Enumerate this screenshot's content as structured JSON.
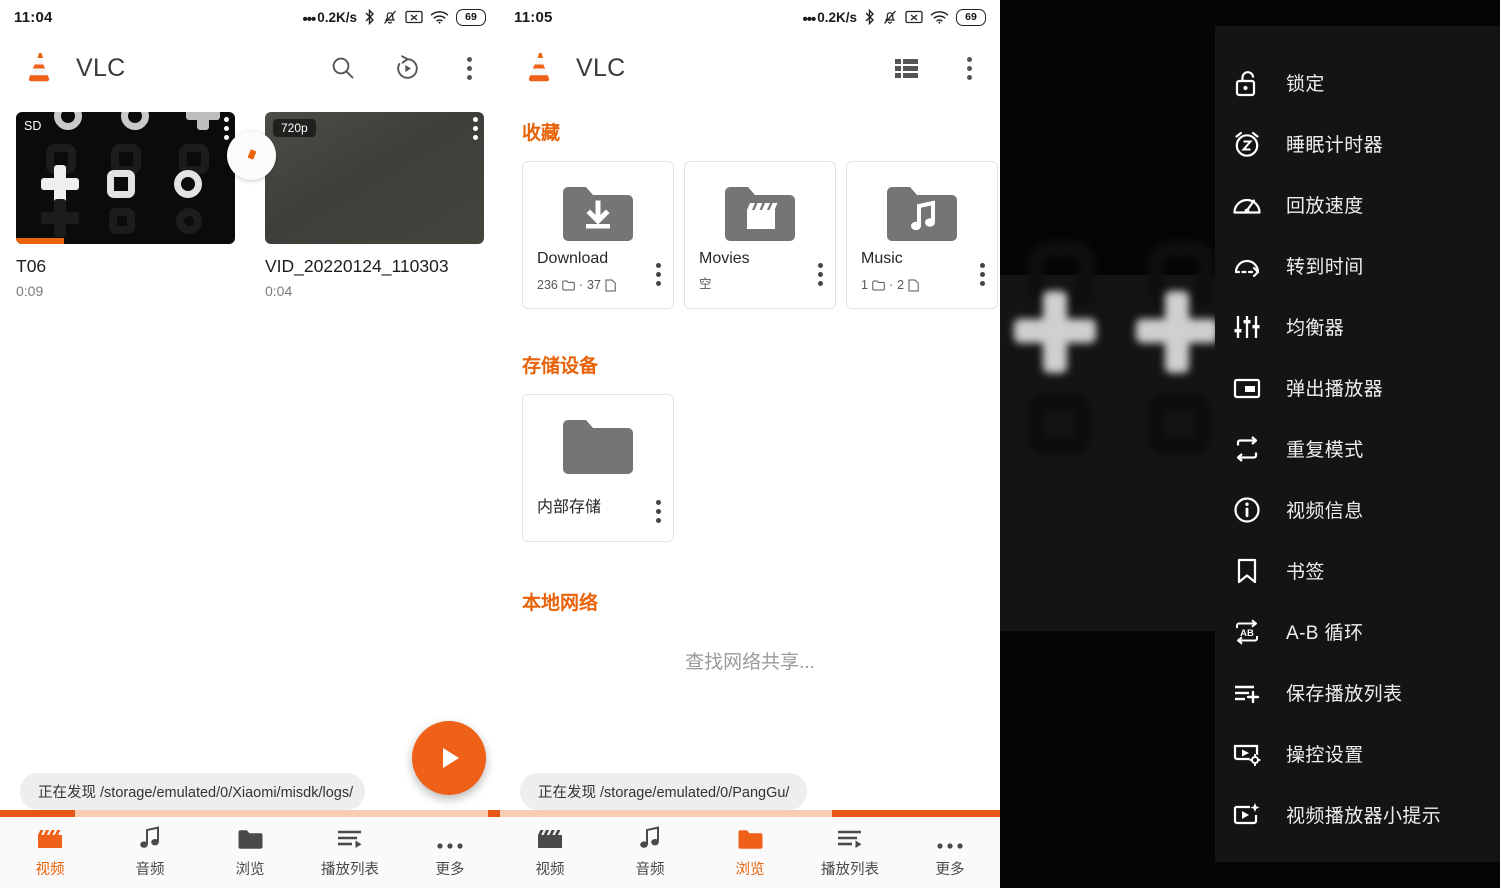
{
  "panels": {
    "left": {
      "statusbar": {
        "time": "11:04",
        "net_speed": "0.2K/s",
        "battery": "69",
        "icons": [
          "bluetooth-icon",
          "notification-muted-icon",
          "no-sim-icon",
          "wifi-icon",
          "battery-icon"
        ]
      },
      "toolbar": {
        "title": "VLC",
        "actions": [
          "search-icon",
          "history-icon",
          "overflow-menu-icon"
        ]
      },
      "videos": [
        {
          "name": "T06",
          "duration": "0:09",
          "quality": "SD",
          "progress_pct": 22
        },
        {
          "name": "VID_20220124_110303",
          "duration": "0:04",
          "quality": "720p",
          "progress_pct": 0
        }
      ],
      "discover_label": "正在发现",
      "discover_path": "/storage/emulated/0/Xiaomi/misdk/logs/",
      "fab": "play-icon",
      "nav": [
        {
          "label": "视频",
          "icon": "clapperboard-icon",
          "active": true
        },
        {
          "label": "音频",
          "icon": "music-note-icon",
          "active": false
        },
        {
          "label": "浏览",
          "icon": "folder-icon",
          "active": false
        },
        {
          "label": "播放列表",
          "icon": "playlist-icon",
          "active": false
        },
        {
          "label": "更多",
          "icon": "more-icon",
          "active": false
        }
      ]
    },
    "middle": {
      "statusbar": {
        "time": "11:05",
        "net_speed": "0.2K/s",
        "battery": "69"
      },
      "toolbar": {
        "title": "VLC",
        "actions": [
          "list-view-icon",
          "overflow-menu-icon"
        ]
      },
      "sections": [
        {
          "title": "收藏",
          "cards": [
            {
              "name": "Download",
              "icon": "folder-download-icon",
              "folders": "236",
              "files": "37",
              "separator": "·",
              "empty": ""
            },
            {
              "name": "Movies",
              "icon": "folder-movie-icon",
              "folders": "",
              "files": "",
              "separator": "",
              "empty": "空"
            },
            {
              "name": "Music",
              "icon": "folder-music-icon",
              "folders": "1",
              "files": "2",
              "separator": "·",
              "empty": ""
            }
          ]
        },
        {
          "title": "存储设备",
          "cards": [
            {
              "name": "内部存储",
              "icon": "folder-icon",
              "folders": "",
              "files": "",
              "separator": "",
              "empty": ""
            }
          ]
        },
        {
          "title": "本地网络",
          "empty_text": "查找网络共享..."
        }
      ],
      "discover_label": "正在发现",
      "discover_path": "/storage/emulated/0/PangGu/",
      "fab": "plus-icon",
      "nav": [
        {
          "label": "视频",
          "icon": "clapperboard-icon",
          "active": false
        },
        {
          "label": "音频",
          "icon": "music-note-icon",
          "active": false
        },
        {
          "label": "浏览",
          "icon": "folder-icon",
          "active": true
        },
        {
          "label": "播放列表",
          "icon": "playlist-icon",
          "active": false
        },
        {
          "label": "更多",
          "icon": "more-icon",
          "active": false
        }
      ]
    },
    "right": {
      "menu_items": [
        {
          "label": "锁定",
          "icon": "lock-open-icon"
        },
        {
          "label": "睡眠计时器",
          "icon": "sleep-timer-icon"
        },
        {
          "label": "回放速度",
          "icon": "speedometer-icon"
        },
        {
          "label": "转到时间",
          "icon": "jump-to-time-icon"
        },
        {
          "label": "均衡器",
          "icon": "equalizer-icon"
        },
        {
          "label": "弹出播放器",
          "icon": "popup-player-icon"
        },
        {
          "label": "重复模式",
          "icon": "repeat-icon"
        },
        {
          "label": "视频信息",
          "icon": "info-icon"
        },
        {
          "label": "书签",
          "icon": "bookmark-icon"
        },
        {
          "label": "A-B 循环",
          "icon": "ab-repeat-icon"
        },
        {
          "label": "保存播放列表",
          "icon": "playlist-add-icon"
        },
        {
          "label": "操控设置",
          "icon": "player-settings-icon"
        },
        {
          "label": "视频播放器小提示",
          "icon": "player-tips-icon"
        }
      ]
    }
  },
  "colors": {
    "accent": "#ef6118",
    "accent_dark": "#e8561a",
    "accent_light": "#f8cdb1",
    "menu_bg": "#141414"
  }
}
